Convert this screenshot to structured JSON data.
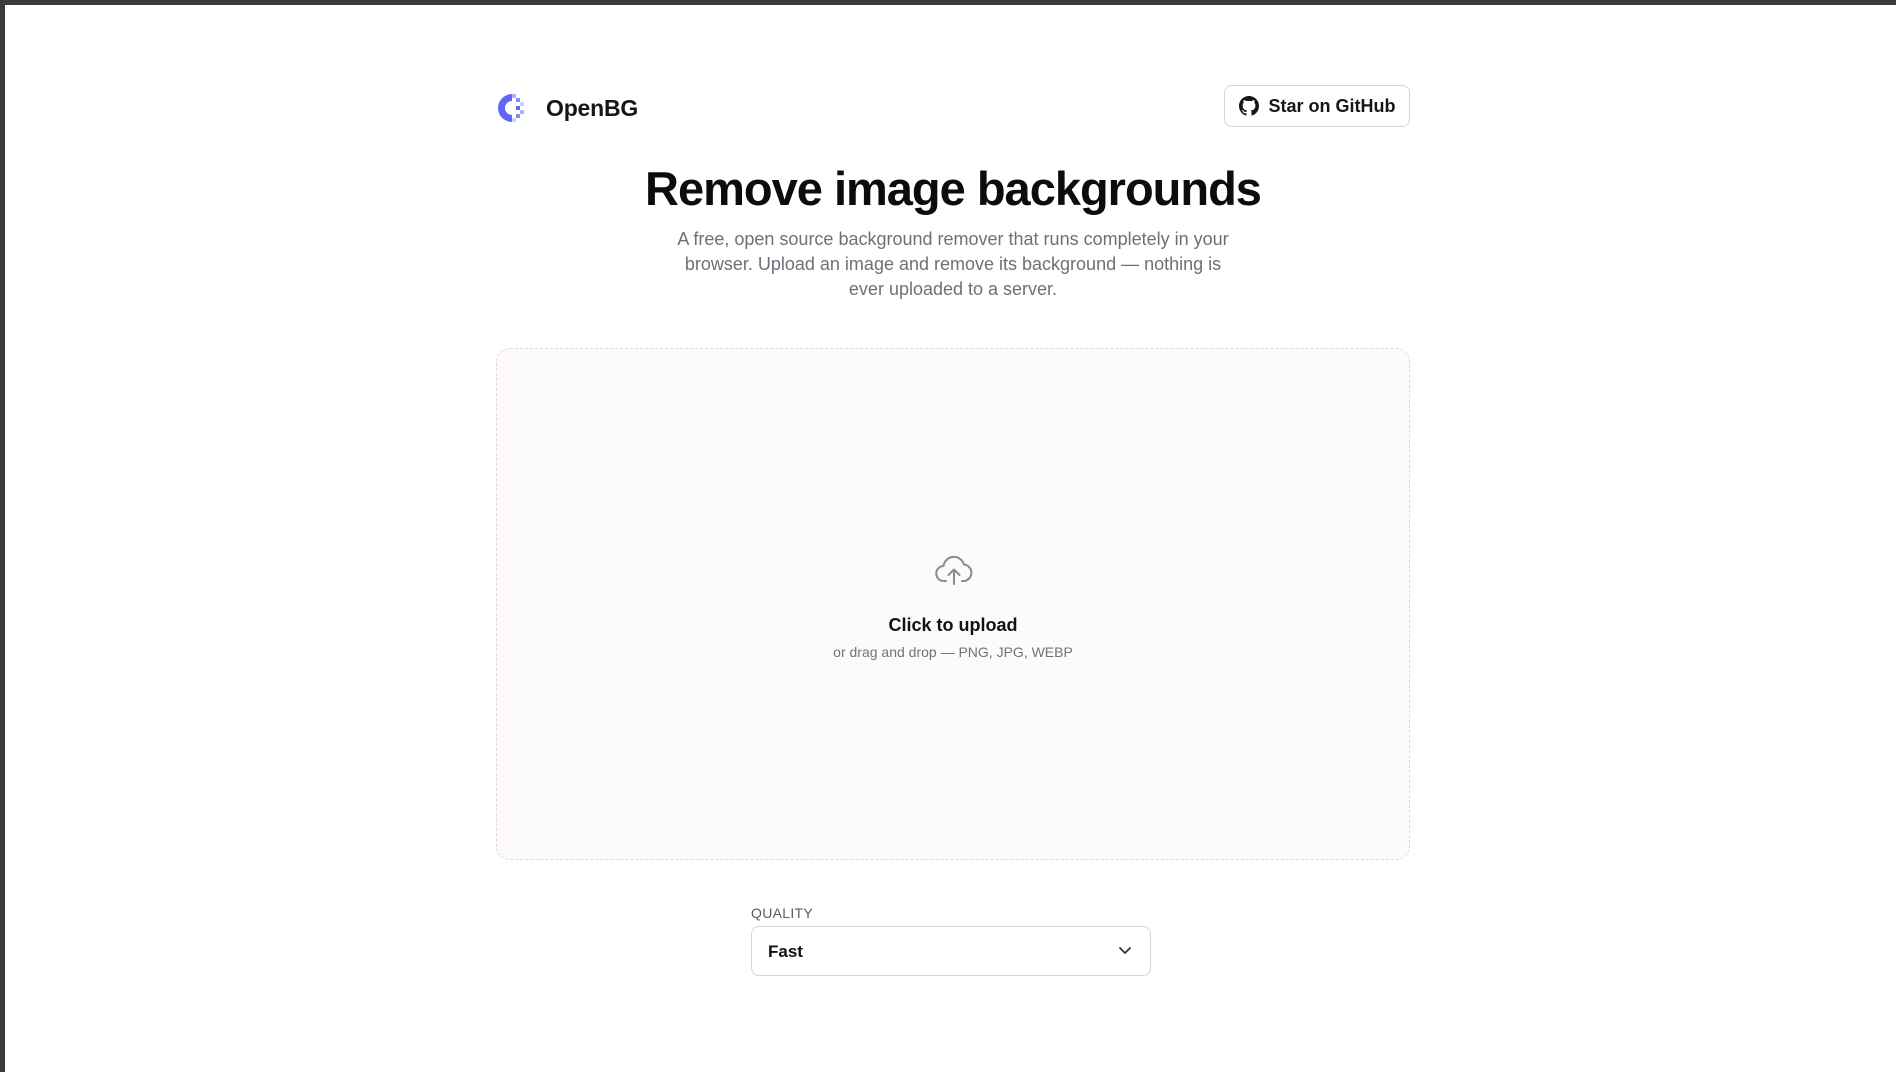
{
  "brand": {
    "name": "OpenBG",
    "logo_icon": "openbg-logo-icon",
    "accent": "#6366f1"
  },
  "header": {
    "github_label": "Star on GitHub",
    "github_icon": "github-icon"
  },
  "hero": {
    "title": "Remove image backgrounds",
    "subtitle": "A free, open source background remover that runs completely in your browser. Upload an image and remove its background — nothing is ever uploaded to a server."
  },
  "upload": {
    "icon": "cloud-upload-icon",
    "title": "Click to upload",
    "hint": "or drag and drop — PNG, JPG, WEBP"
  },
  "quality": {
    "label": "QUALITY",
    "selected": "Fast",
    "icon": "chevron-down-icon"
  }
}
